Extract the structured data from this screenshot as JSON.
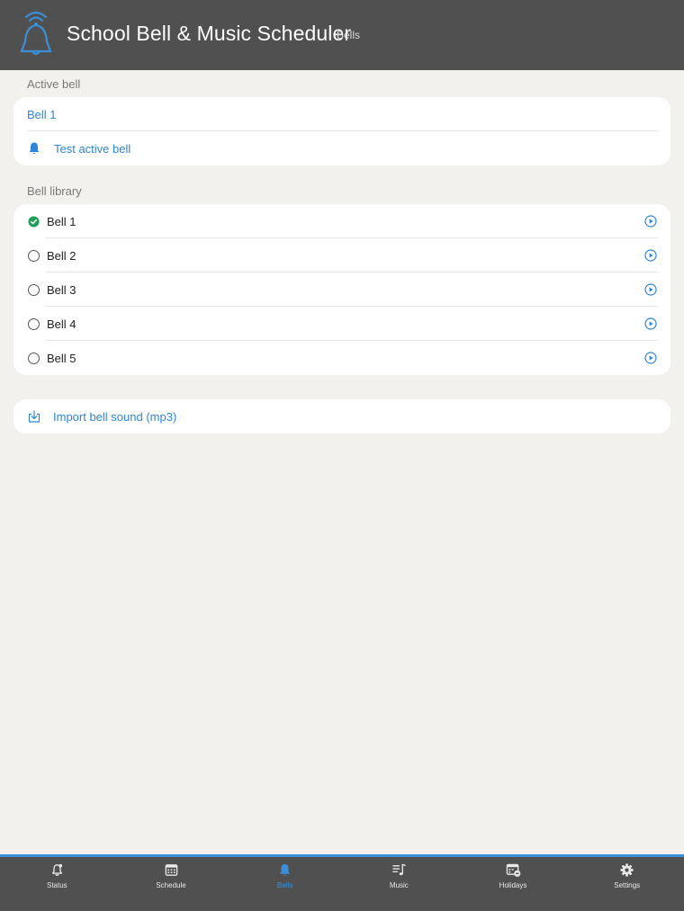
{
  "header": {
    "title": "School Bell & Music Scheduler",
    "subtitle": "Bells"
  },
  "active_bell": {
    "section_label": "Active bell",
    "name": "Bell 1",
    "test_label": "Test active bell"
  },
  "library": {
    "section_label": "Bell library",
    "items": [
      {
        "label": "Bell 1",
        "selected": true
      },
      {
        "label": "Bell 2",
        "selected": false
      },
      {
        "label": "Bell 3",
        "selected": false
      },
      {
        "label": "Bell 4",
        "selected": false
      },
      {
        "label": "Bell 5",
        "selected": false
      }
    ]
  },
  "import": {
    "label": "Import bell sound (mp3)"
  },
  "tabs": [
    {
      "label": "Status",
      "icon": "bell-alert-icon",
      "active": false
    },
    {
      "label": "Schedule",
      "icon": "calendar-icon",
      "active": false
    },
    {
      "label": "Bells",
      "icon": "bell-icon",
      "active": true
    },
    {
      "label": "Music",
      "icon": "music-list-icon",
      "active": false
    },
    {
      "label": "Holidays",
      "icon": "calendar-minus-icon",
      "active": false
    },
    {
      "label": "Settings",
      "icon": "gear-icon",
      "active": false
    }
  ],
  "colors": {
    "accent": "#2f86d6",
    "header_bg": "#505050",
    "page_bg": "#f2f1ee",
    "selected_green": "#1e9e5a"
  }
}
